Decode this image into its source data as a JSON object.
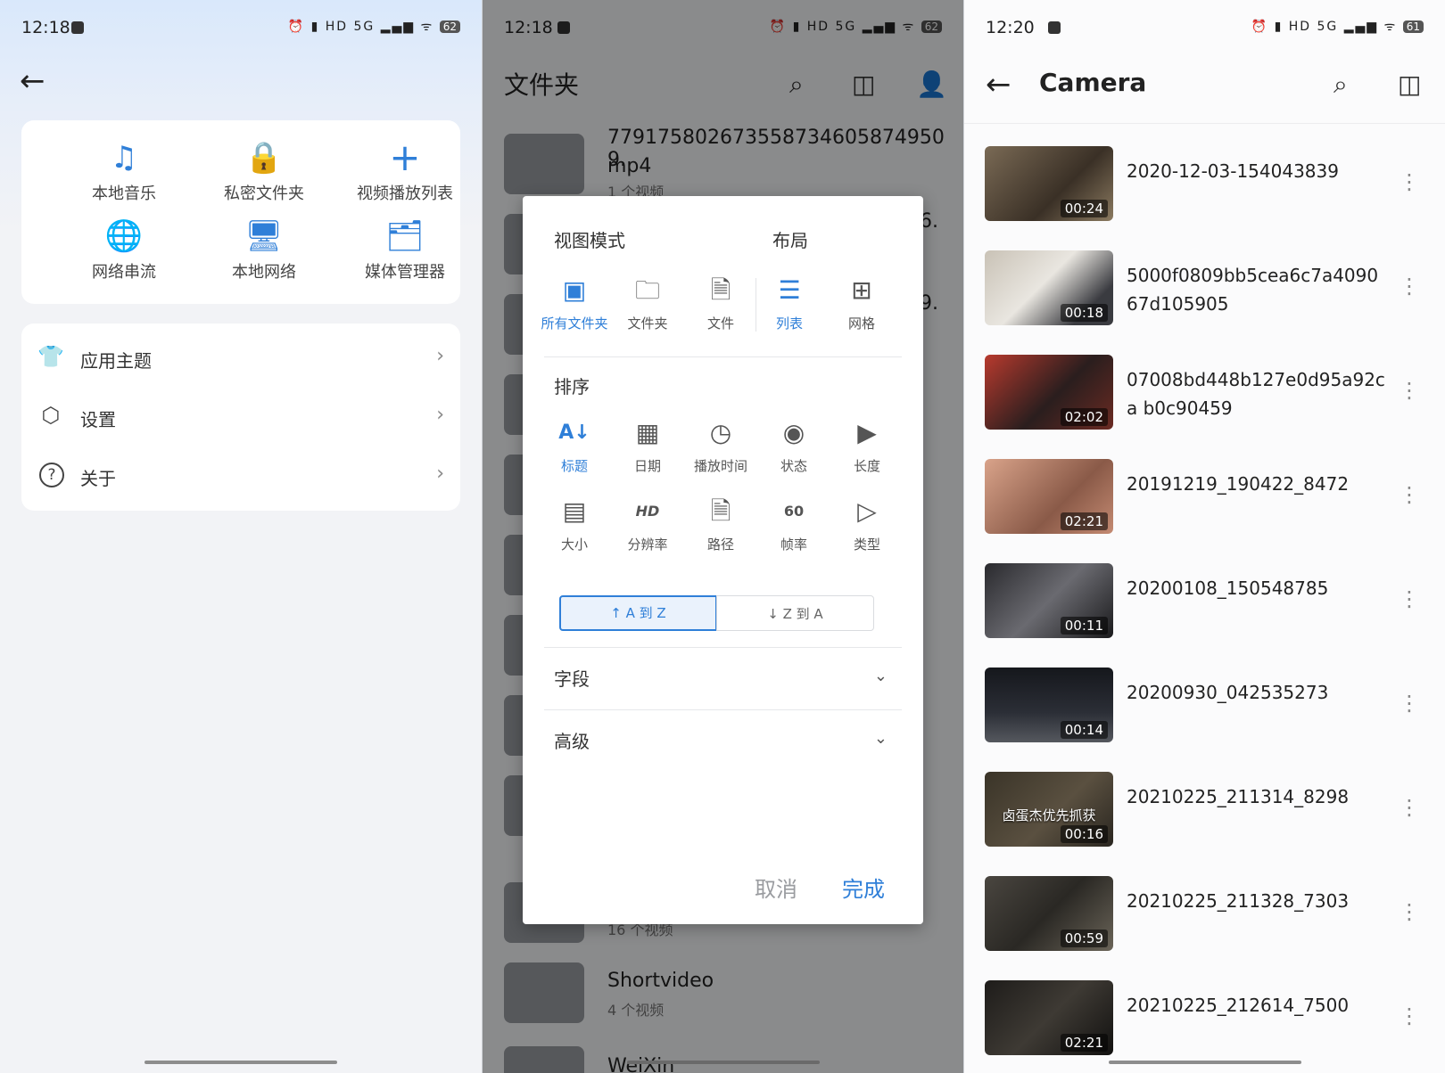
{
  "panel1": {
    "status": {
      "time": "12:18",
      "icons": "⏰ ▮ HD 5G ▂▄▆ ᯤ",
      "battery": "62"
    },
    "back_icon": "arrow-left-icon",
    "quick": [
      {
        "label": "本地音乐",
        "icon": "♫"
      },
      {
        "label": "私密文件夹",
        "icon": "🔒"
      },
      {
        "label": "视频播放列表",
        "icon": "+"
      },
      {
        "label": "网络串流",
        "icon": "🌐"
      },
      {
        "label": "本地网络",
        "icon": "🖥"
      },
      {
        "label": "媒体管理器",
        "icon": "🗂"
      }
    ],
    "menu": [
      {
        "label": "应用主题",
        "icon": "👕"
      },
      {
        "label": "设置",
        "icon": "⬡"
      },
      {
        "label": "关于",
        "icon": "?"
      }
    ]
  },
  "panel2": {
    "status": {
      "time": "12:18",
      "icons": "⏰ ▮ HD 5G ▂▄▆ ᯤ",
      "battery": "62"
    },
    "title": "文件夹",
    "bg_rows": [
      {
        "name": "779175802673558734605874950 9.",
        "name2": "mp4",
        "sub": "1 个视频"
      },
      {
        "name": "Shortvideo",
        "sub": "4 个视频"
      },
      {
        "name": "WeiXin",
        "sub": ""
      }
    ],
    "bg_frag": {
      "a": "6.",
      "b": "9.",
      "c": "16 个视频"
    },
    "dialog": {
      "view_mode_title": "视图模式",
      "layout_title": "布局",
      "view_modes": [
        {
          "label": "所有文件夹",
          "icon": "▣"
        },
        {
          "label": "文件夹",
          "icon": "🗀"
        },
        {
          "label": "文件",
          "icon": "🗎"
        }
      ],
      "layouts": [
        {
          "label": "列表",
          "icon": "☰"
        },
        {
          "label": "网格",
          "icon": "⊞"
        }
      ],
      "sort_title": "排序",
      "sorts": [
        {
          "label": "标题",
          "icon": "A↓"
        },
        {
          "label": "日期",
          "icon": "▦"
        },
        {
          "label": "播放时间",
          "icon": "◷"
        },
        {
          "label": "状态",
          "icon": "◉"
        },
        {
          "label": "长度",
          "icon": "▶"
        },
        {
          "label": "大小",
          "icon": "▤"
        },
        {
          "label": "分辨率",
          "icon": "HD"
        },
        {
          "label": "路径",
          "icon": "🗎"
        },
        {
          "label": "帧率",
          "icon": "60"
        },
        {
          "label": "类型",
          "icon": "▷"
        }
      ],
      "order_asc": "↑ A 到 Z",
      "order_desc": "↓ Z 到 A",
      "fields": "字段",
      "advanced": "高级",
      "cancel": "取消",
      "done": "完成"
    }
  },
  "panel3": {
    "status": {
      "time": "12:20",
      "icons": "⏰ ▮ HD 5G ▂▄▆ ᯤ",
      "battery": "61"
    },
    "title": "Camera",
    "videos": [
      {
        "name": "2020-12-03-154043839",
        "duration": "00:24",
        "overlay": ""
      },
      {
        "name": "5000f0809bb5cea6c7a4090 67d105905",
        "duration": "00:18",
        "overlay": ""
      },
      {
        "name": "07008bd448b127e0d95a92ca b0c90459",
        "duration": "02:02",
        "overlay": ""
      },
      {
        "name": "20191219_190422_8472",
        "duration": "02:21",
        "overlay": ""
      },
      {
        "name": "20200108_150548785",
        "duration": "00:11",
        "overlay": ""
      },
      {
        "name": "20200930_042535273",
        "duration": "00:14",
        "overlay": ""
      },
      {
        "name": "20210225_211314_8298",
        "duration": "00:16",
        "overlay": "卤蛋杰优先抓获"
      },
      {
        "name": "20210225_211328_7303",
        "duration": "00:59",
        "overlay": ""
      },
      {
        "name": "20210225_212614_7500",
        "duration": "02:21",
        "overlay": ""
      }
    ]
  },
  "colors": {
    "accent": "#2f7fd8",
    "dialog_bg": "#ffffff",
    "overlay": "#000000"
  }
}
